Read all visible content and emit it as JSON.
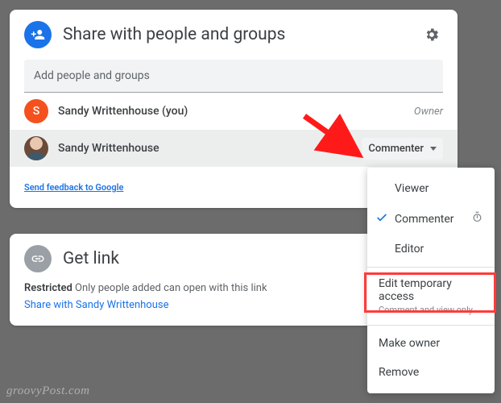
{
  "share_card": {
    "title": "Share with people and groups",
    "add_placeholder": "Add people and groups",
    "people": [
      {
        "name": "Sandy Writtenhouse (you)",
        "initial": "S",
        "role": "Owner"
      },
      {
        "name": "Sandy Writtenhouse",
        "role": "Commenter"
      }
    ],
    "feedback_text": "Send feedback to Google"
  },
  "link_card": {
    "title": "Get link",
    "restricted_bold": "Restricted",
    "restricted_rest": " Only people added can open with this link",
    "share_with_text": "Share with Sandy Writtenhouse"
  },
  "menu": {
    "viewer": "Viewer",
    "commenter": "Commenter",
    "editor": "Editor",
    "edit_temp": "Edit temporary access",
    "edit_temp_sub": "Comment and view only",
    "make_owner": "Make owner",
    "remove": "Remove"
  },
  "watermark": "groovyPost.com"
}
